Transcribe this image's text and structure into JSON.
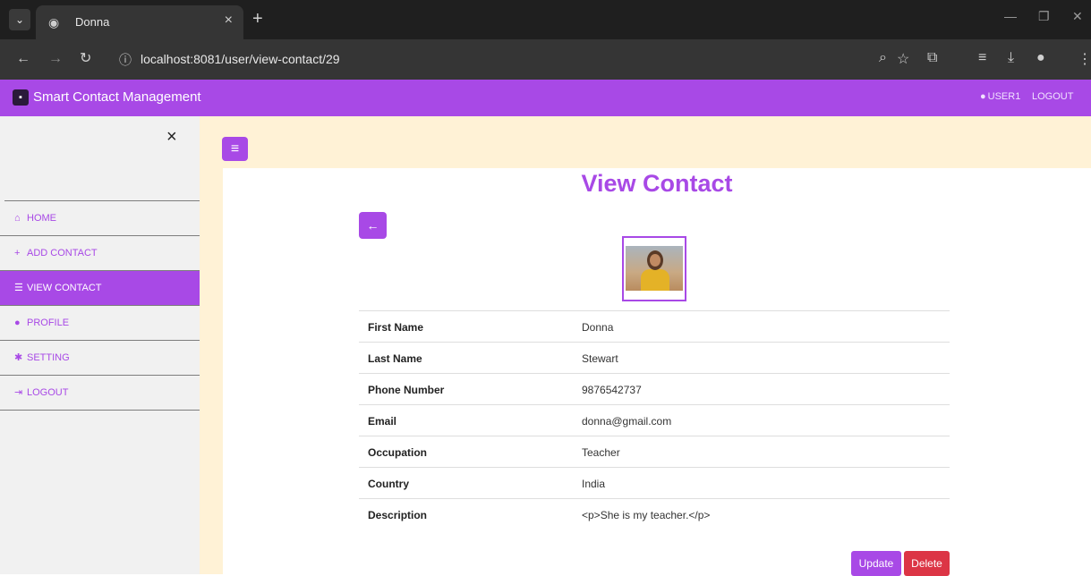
{
  "browser": {
    "tab_title": "Donna",
    "url": "localhost:8081/user/view-contact/29"
  },
  "navbar": {
    "brand": "Smart Contact Management",
    "user": "USER1",
    "logout": "LOGOUT"
  },
  "sidebar": {
    "items": [
      {
        "icon": "home-icon",
        "label": "HOME"
      },
      {
        "icon": "plus-icon",
        "label": "ADD CONTACT"
      },
      {
        "icon": "list-icon",
        "label": "VIEW CONTACT",
        "active": true
      },
      {
        "icon": "user-icon",
        "label": "PROFILE"
      },
      {
        "icon": "gear-icon",
        "label": "SETTING"
      },
      {
        "icon": "sign-out-icon",
        "label": "LOGOUT"
      }
    ]
  },
  "main": {
    "title": "View Contact",
    "fields": [
      {
        "label": "First Name",
        "value": "Donna"
      },
      {
        "label": "Last Name",
        "value": "Stewart"
      },
      {
        "label": "Phone Number",
        "value": "9876542737"
      },
      {
        "label": "Email",
        "value": "donna@gmail.com"
      },
      {
        "label": "Occupation",
        "value": "Teacher"
      },
      {
        "label": "Country",
        "value": "India"
      },
      {
        "label": "Description",
        "value": "<p>She is my teacher.</p>"
      }
    ],
    "update_label": "Update",
    "delete_label": "Delete"
  },
  "colors": {
    "accent": "#a849e6",
    "danger": "#dc3545",
    "content_bg": "#fff2d6"
  }
}
